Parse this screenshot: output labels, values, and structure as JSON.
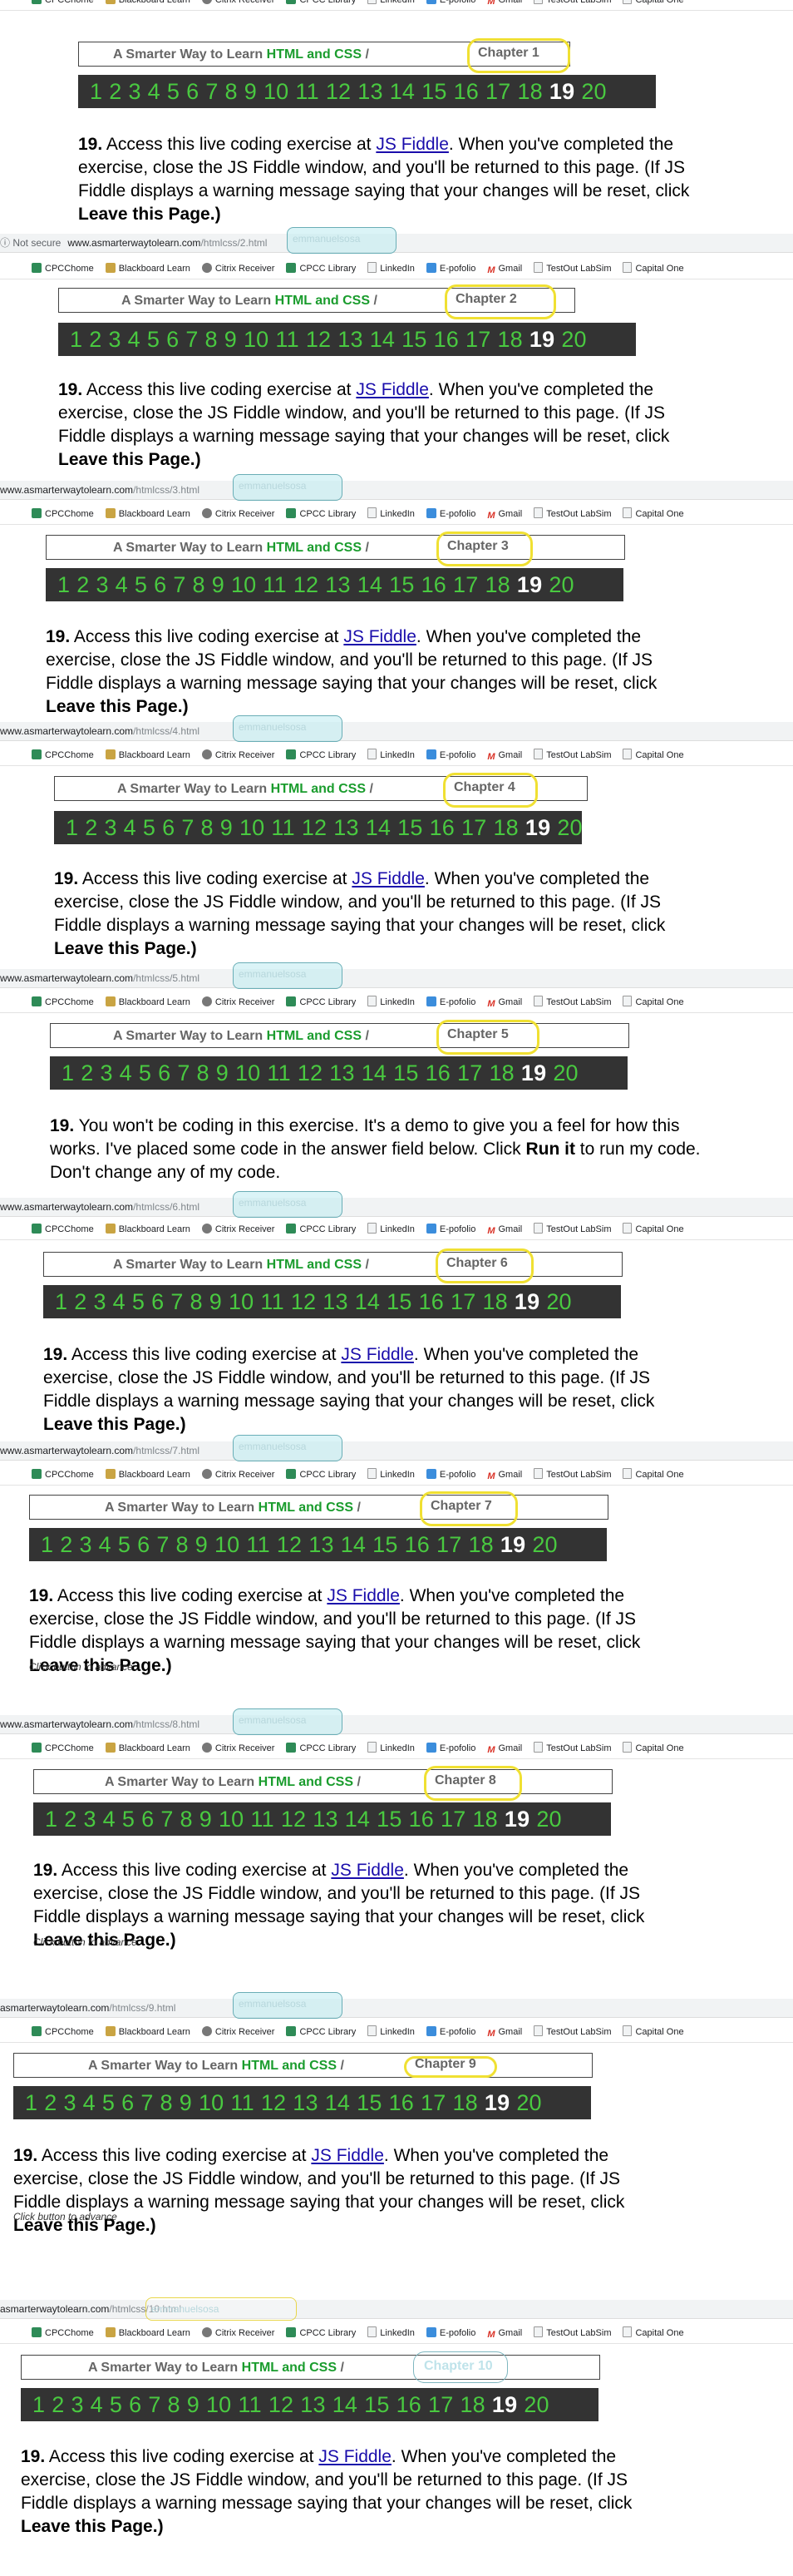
{
  "bookmarks": [
    "CPCChome",
    "Blackboard Learn",
    "Citrix Receiver",
    "CPCC Library",
    "LinkedIn",
    "E-pofolio",
    "Gmail",
    "TestOut LabSim",
    "Capital One"
  ],
  "header": {
    "prefix": "A Smarter Way to Learn ",
    "accent": "HTML and CSS",
    "sep": "/"
  },
  "chapter_numbers": [
    "1",
    "2",
    "3",
    "4",
    "5",
    "6",
    "7",
    "8",
    "9",
    "10",
    "11",
    "12",
    "13",
    "14",
    "15",
    "16",
    "17",
    "18",
    "19",
    "20"
  ],
  "current_number": "19",
  "exercise": {
    "num": "19.",
    "pre": " Access this live coding exercise at ",
    "link": "JS Fiddle",
    "post": ". When you've completed the exercise, close the JS Fiddle window, and you'll be returned to this page. (If JS Fiddle displays a warning message saying that your changes will be reset, click ",
    "bold_end": "Leave this Page.)"
  },
  "demo_exercise": {
    "num": "19.",
    "pre": " You won't be coding in this exercise. It's a demo to give you a feel for how this works. I've placed some code in the answer field below. Click ",
    "run": "Run",
    "run_bold_tail": " it",
    "post": " to run my code. Don't change any of my code."
  },
  "advance_note": "Click button to advance",
  "not_secure": "Not secure",
  "segments": [
    {
      "chapter": "Chapter 1",
      "url_host": "",
      "url_path": ""
    },
    {
      "chapter": "Chapter 2",
      "url_host": "www.asmarterwaytolearn.com",
      "url_path": "/htmlcss/2.html"
    },
    {
      "chapter": "Chapter 3",
      "url_host": "www.asmarterwaytolearn.com",
      "url_path": "/htmlcss/3.html"
    },
    {
      "chapter": "Chapter 4",
      "url_host": "www.asmarterwaytolearn.com",
      "url_path": "/htmlcss/4.html"
    },
    {
      "chapter": "Chapter 5",
      "url_host": "www.asmarterwaytolearn.com",
      "url_path": "/htmlcss/5.html"
    },
    {
      "chapter": "Chapter 6",
      "url_host": "www.asmarterwaytolearn.com",
      "url_path": "/htmlcss/6.html"
    },
    {
      "chapter": "Chapter 7",
      "url_host": "www.asmarterwaytolearn.com",
      "url_path": "/htmlcss/7.html"
    },
    {
      "chapter": "Chapter 8",
      "url_host": "www.asmarterwaytolearn.com",
      "url_path": "/htmlcss/8.html"
    },
    {
      "chapter": "Chapter 9",
      "url_host": "asmarterwaytolearn.com",
      "url_path": "/htmlcss/9.html"
    },
    {
      "chapter": "Chapter 10",
      "url_host": "asmarterwaytolearn.com",
      "url_path": "/htmlcss/10.html"
    }
  ],
  "url_overlay_text": "emmanuelsosa"
}
